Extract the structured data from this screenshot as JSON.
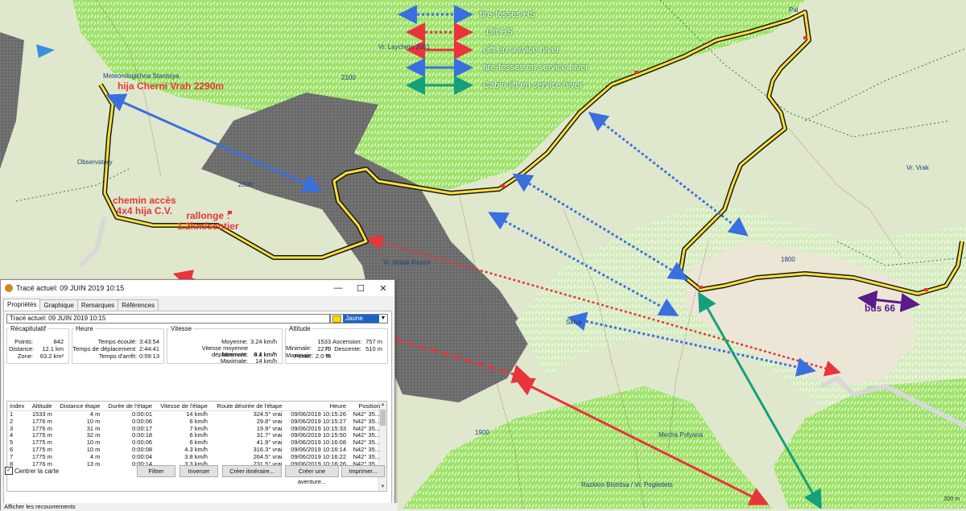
{
  "legend": [
    {
      "label": "tire-fesses HS",
      "color": "#3a6fe0",
      "style": "dotted"
    },
    {
      "label": "Lift HS",
      "color": "#e8343a",
      "style": "dotted"
    },
    {
      "label": "Lift en service hiver",
      "color": "#e8343a",
      "style": "solid"
    },
    {
      "label": "tire-fesses en service hiver",
      "color": "#3a6fe0",
      "style": "solid"
    },
    {
      "label": "Cabin-lift en service hiver",
      "color": "#14a07a",
      "style": "solid"
    }
  ],
  "annotations": {
    "summit": "hija Cherni Vrah 2290m",
    "access_line1": "chemin accès",
    "access_line2": "4x4 hija C.V.",
    "extension_line1": "rallonge :",
    "extension_line2": "1.2km/sentier",
    "bus": "bus 66"
  },
  "map_places": {
    "meteo": "Meteorologichna Stantsiya",
    "observatory": "Observatory",
    "laycheto": "Vr. Laycheto 2051",
    "malak_rezen": "Vr. Malak Rezen",
    "mecha_polyana": "Mecha Polyana",
    "razklon": "Razklon Bistritsa / Vr. Pogledets",
    "vrak": "Vr. Vrak",
    "pal": "Pal",
    "skiva": "Skiva",
    "elevation_1800": "1800",
    "elevation_1900": "1900",
    "elevation_2000": "2000",
    "elevation_2100": "2100",
    "scale": "200 m"
  },
  "colors": {
    "track_yellow": "#ffe03a",
    "forest_green": "#7ad64a",
    "rock_gray": "#6f6f6f",
    "red_arrow": "#e8343a",
    "blue_arrow": "#3a6fe0",
    "teal_arrow": "#14a07a",
    "purple_arrow": "#5a1a8a"
  },
  "dialog": {
    "title": "Tracé actuel: 09 JUIN 2019 10:15",
    "tabs": [
      "Propriétés",
      "Graphique",
      "Remarques",
      "Références"
    ],
    "track_name": "Tracé actuel: 09 JUIN 2019 10:15",
    "color_value": "Jaune",
    "summary": {
      "legend": "Récapitulatif",
      "points_label": "Points:",
      "points": "842",
      "distance_label": "Distance:",
      "distance": "12.1 km",
      "zone_label": "Zone:",
      "zone": "63.2 km²"
    },
    "time": {
      "legend": "Heure",
      "elapsed_label": "Temps écoulé:",
      "elapsed": "3:43:54",
      "moving_label": "Temps de déplacement:",
      "moving": "2:44:41",
      "stopped_label": "Temps d'arrêt:",
      "stopped": "0:59:13"
    },
    "speed": {
      "legend": "Vitesse",
      "avg_label": "Moyenne:",
      "avg": "3.24 km/h",
      "moving_avg_label": "Vitesse moyenne déplacement:",
      "moving_avg": "4.4 km/h",
      "min_label": "Minimale:",
      "min": "0.1 km/h",
      "max_label": "Maximale:",
      "max": "14 km/h"
    },
    "altitude": {
      "legend": "Altitude",
      "min_label": "Minimale:",
      "min": "1533 m",
      "max_label": "Maximale:",
      "max": "2270 m",
      "slope_label": "Pente:",
      "slope": "2.0 %",
      "ascent_label": "Ascension:",
      "ascent": "757 m",
      "descent_label": "Descente:",
      "descent": "510 m"
    },
    "table": {
      "headers": [
        "Index",
        "Altitude",
        "Distance étape",
        "Durée de l'étape",
        "Vitesse de l'étape",
        "Route désirée de l'étape",
        "Heure",
        "Position"
      ],
      "rows": [
        [
          "1",
          "1533 m",
          "4 m",
          "0:00:01",
          "14 km/h",
          "324.5° vrai",
          "09/06/2019 10:15:26",
          "N42° 35..."
        ],
        [
          "2",
          "1776 m",
          "10 m",
          "0:00:06",
          "6 km/h",
          "29.8° vrai",
          "09/06/2019 10:15:27",
          "N42° 35..."
        ],
        [
          "3",
          "1776 m",
          "31 m",
          "0:00:17",
          "7 km/h",
          "19.9° vrai",
          "09/06/2019 10:15:33",
          "N42° 35..."
        ],
        [
          "4",
          "1775 m",
          "32 m",
          "0:00:18",
          "6 km/h",
          "31.7° vrai",
          "09/06/2019 10:15:50",
          "N42° 35..."
        ],
        [
          "5",
          "1775 m",
          "10 m",
          "0:00:06",
          "6 km/h",
          "41.9° vrai",
          "09/06/2019 10:16:08",
          "N42° 35..."
        ],
        [
          "6",
          "1775 m",
          "10 m",
          "0:00:08",
          "4.3 km/h",
          "316.3° vrai",
          "09/06/2019 10:16:14",
          "N42° 35..."
        ],
        [
          "7",
          "1775 m",
          "4 m",
          "0:00:04",
          "3.8 km/h",
          "264.5° vrai",
          "09/06/2019 10:16:22",
          "N42° 35..."
        ],
        [
          "8",
          "1776 m",
          "13 m",
          "0:00:14",
          "3.3 km/h",
          "231.5° vrai",
          "09/06/2019 10:16:26",
          "N42° 35..."
        ]
      ]
    },
    "center_map_label": "Centrer la carte",
    "buttons": {
      "filter": "Filtrer",
      "invert": "Inverser",
      "create_route": "Créer itinéraire...",
      "create_adventure": "Créer une aventure...",
      "print": "Imprimer..."
    },
    "status": "Afficher les recouvrements"
  }
}
